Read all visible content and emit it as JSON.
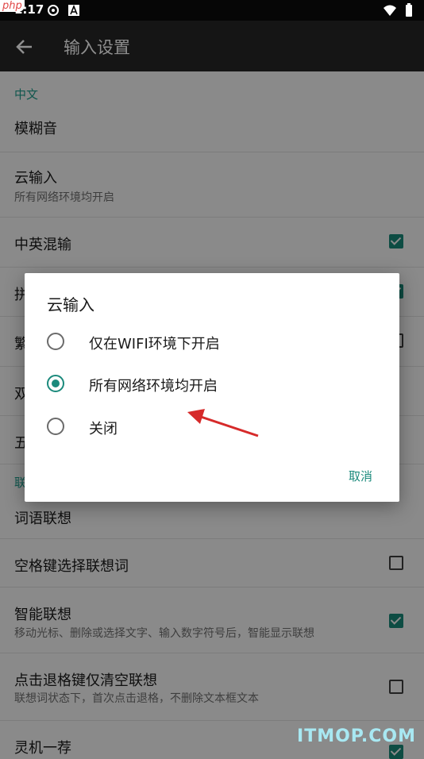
{
  "status": {
    "time": "1:17",
    "logo": "php"
  },
  "appbar": {
    "title": "输入设置"
  },
  "sections": {
    "chinese": {
      "header": "中文"
    },
    "assoc": {
      "header": "联"
    }
  },
  "rows": {
    "fuzzy": {
      "title": "模糊音"
    },
    "cloud": {
      "title": "云输入",
      "summary": "所有网络环境均开启"
    },
    "mixed": {
      "title": "中英混输"
    },
    "pin": {
      "title": "拼"
    },
    "trad": {
      "title": "繁"
    },
    "dbl": {
      "title": "双"
    },
    "wu": {
      "title": "五"
    },
    "phrase": {
      "title": "词语联想"
    },
    "space": {
      "title": "空格键选择联想词"
    },
    "smart": {
      "title": "智能联想",
      "summary": "移动光标、删除或选择文字、输入数字符号后，智能显示联想"
    },
    "backsp": {
      "title": "点击退格键仅清空联想",
      "summary": "联想词状态下，首次点击退格，不删除文本框文本"
    },
    "lingji": {
      "title": "灵机一荐"
    }
  },
  "dialog": {
    "title": "云输入",
    "options": [
      "仅在WIFI环境下开启",
      "所有网络环境均开启",
      "关闭"
    ],
    "selected": "所有网络环境均开启",
    "cancel": "取消"
  },
  "colors": {
    "accent": "#1b8a7c",
    "checkbox": "#0d4c43"
  },
  "watermark": "ITMOP.COM"
}
